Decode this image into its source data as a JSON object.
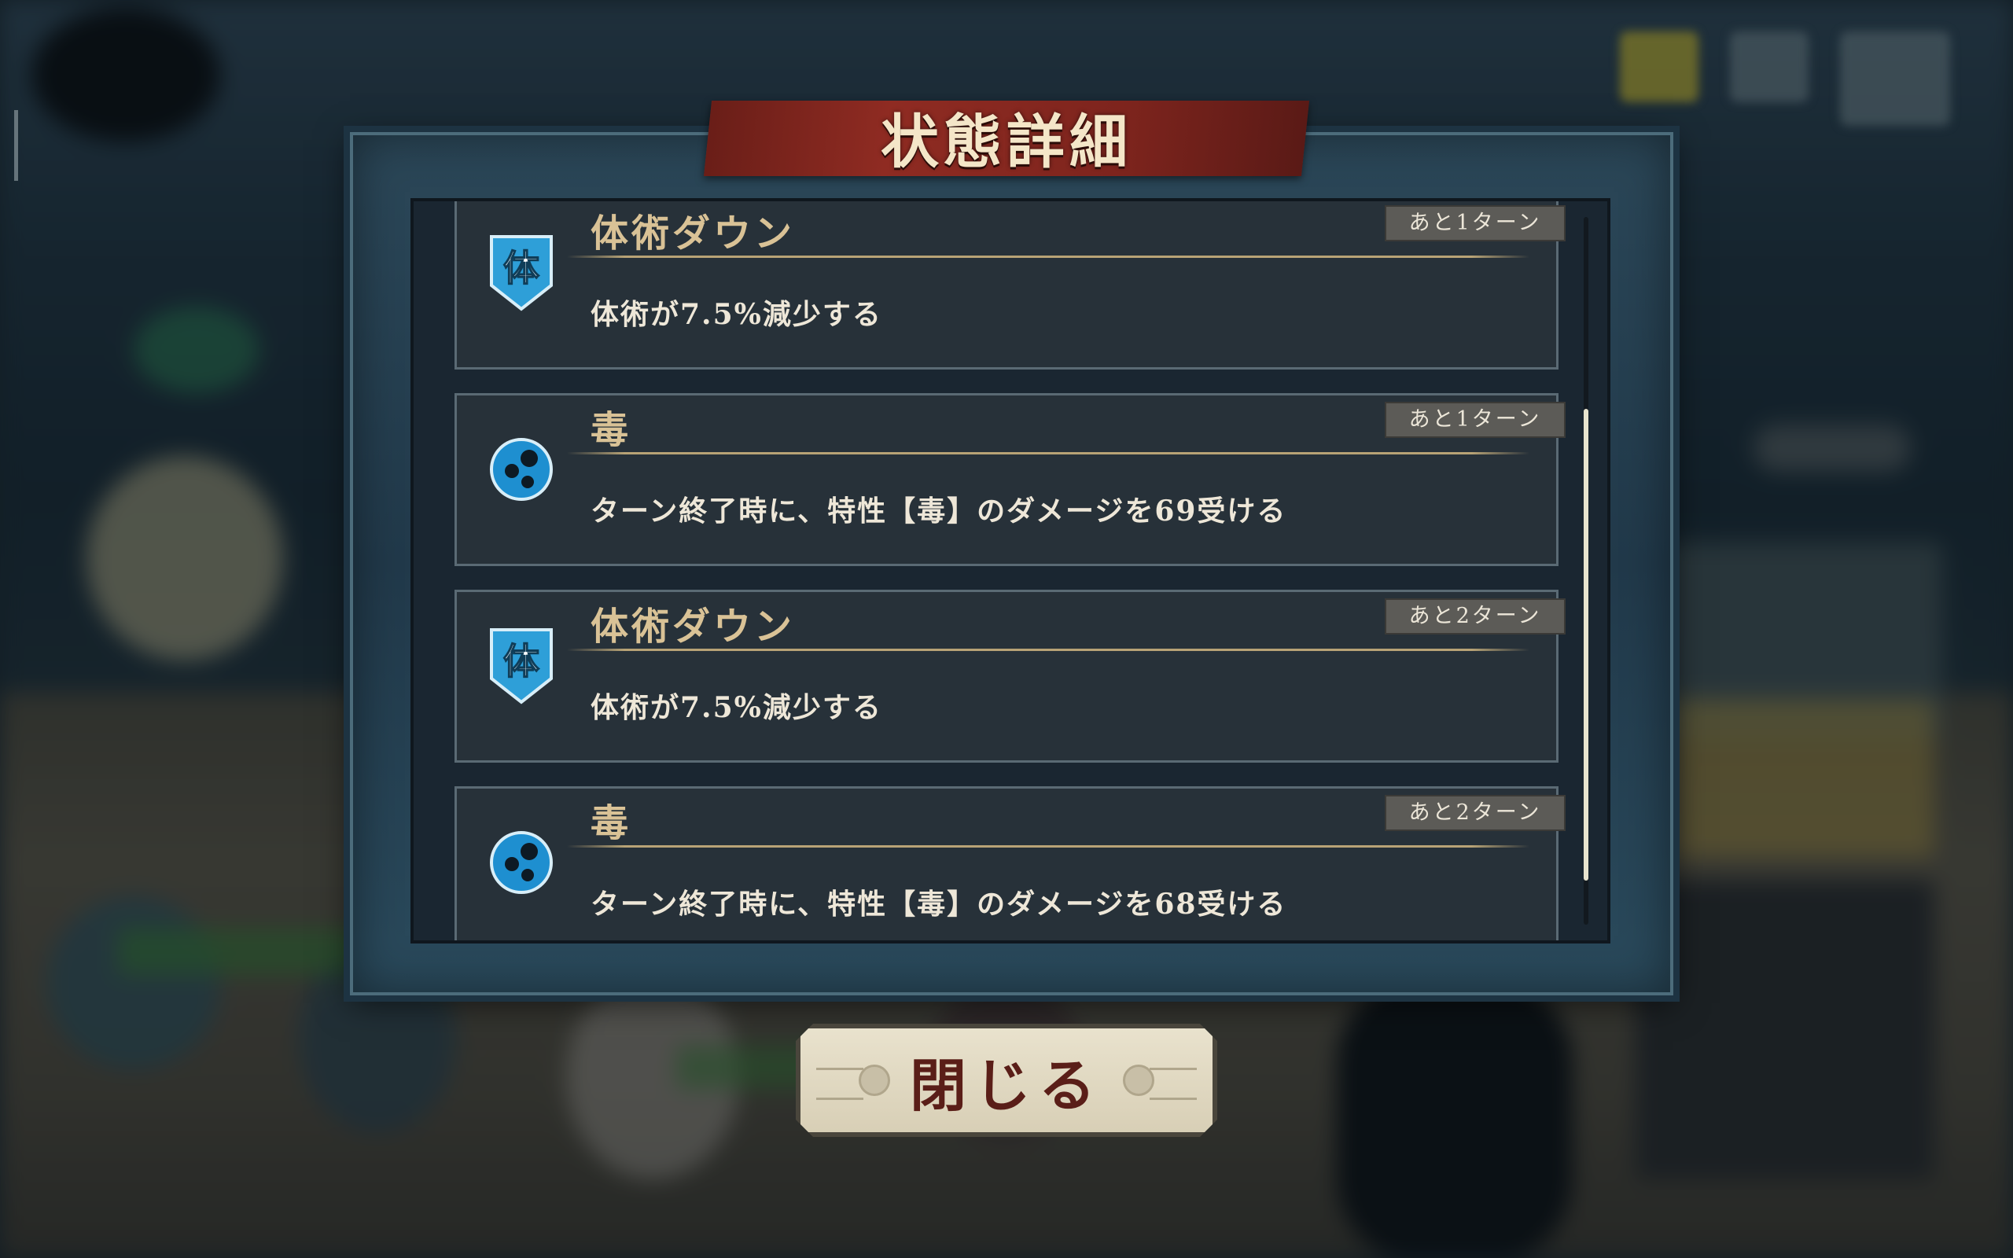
{
  "dialog": {
    "title": "状態詳細",
    "close_label": "閉じる"
  },
  "statuses": [
    {
      "icon": "taijutsu-shield-icon",
      "icon_char": "体",
      "name": "体術ダウン",
      "turns": "あと1ターン",
      "desc": "体術が7.5%減少する"
    },
    {
      "icon": "poison-icon",
      "name": "毒",
      "turns": "あと1ターン",
      "desc": "ターン終了時に、特性【毒】のダメージを69受ける"
    },
    {
      "icon": "taijutsu-shield-icon",
      "icon_char": "体",
      "name": "体術ダウン",
      "turns": "あと2ターン",
      "desc": "体術が7.5%減少する"
    },
    {
      "icon": "poison-icon",
      "name": "毒",
      "turns": "あと2ターン",
      "desc": "ターン終了時に、特性【毒】のダメージを68受ける"
    }
  ],
  "colors": {
    "title_banner": "#8f2b22",
    "status_name": "#d9c296",
    "icon_blue": "#2e9fd8",
    "close_text": "#5a1e18"
  }
}
